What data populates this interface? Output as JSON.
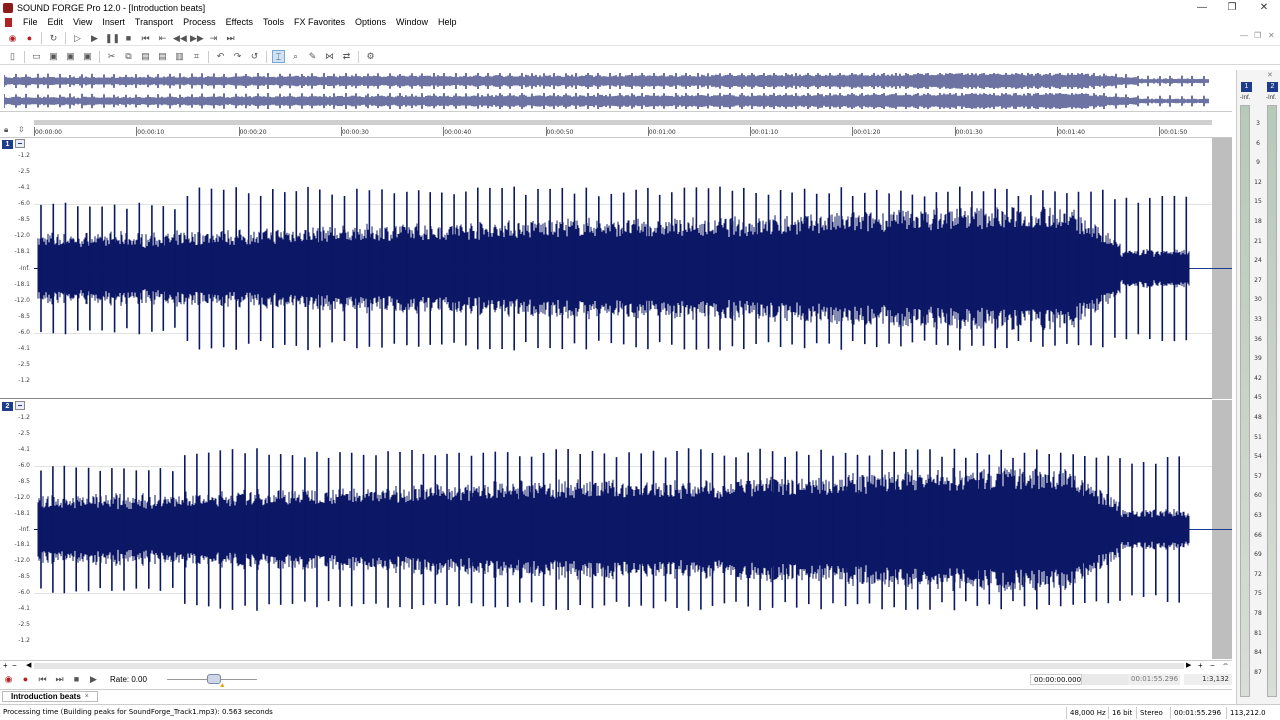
{
  "window": {
    "title": "SOUND FORGE Pro 12.0 - [Introduction beats]",
    "min_glyph": "—",
    "max_glyph": "❐",
    "close_glyph": "✕"
  },
  "menu": [
    "File",
    "Edit",
    "View",
    "Insert",
    "Transport",
    "Process",
    "Effects",
    "Tools",
    "FX Favorites",
    "Options",
    "Window",
    "Help"
  ],
  "transport_icons": [
    "record-arm-icon",
    "record-icon",
    "loop-icon",
    "play-all-icon",
    "play-icon",
    "pause-icon",
    "stop-icon",
    "go-to-start-icon",
    "previous-icon",
    "rewind-icon",
    "forward-icon",
    "next-icon",
    "go-to-end-icon"
  ],
  "standard_icons": [
    "new-icon",
    "open-icon",
    "save-icon",
    "save-as-icon",
    "save-all-icon",
    "cut-icon",
    "copy-icon",
    "paste-icon",
    "mix-icon",
    "crop-icon",
    "trim-icon",
    "undo-icon",
    "redo-icon",
    "repeat-icon",
    "edit-tool-icon",
    "magnify-tool-icon",
    "pencil-tool-icon",
    "envelope-tool-icon",
    "event-tool-icon",
    "plugin-chainer-icon"
  ],
  "ruler": {
    "labels": [
      "00:00:00",
      "00:00:10",
      "00:00:20",
      "00:00:30",
      "00:00:40",
      "00:00:50",
      "00:01:00",
      "00:01:10",
      "00:01:20",
      "00:01:30",
      "00:01:40",
      "00:01:50"
    ]
  },
  "channels": [
    {
      "id": "1",
      "db_labels": [
        "-1.2",
        "-2.5",
        "-4.1",
        "-6.0",
        "-8.5",
        "-12.0",
        "-18.1",
        "-Inf.",
        "-18.1",
        "-12.0",
        "-8.5",
        "-6.0",
        "-4.1",
        "-2.5",
        "-1.2"
      ]
    },
    {
      "id": "2",
      "db_labels": [
        "-1.2",
        "-2.5",
        "-4.1",
        "-6.0",
        "-8.5",
        "-12.0",
        "-18.1",
        "-Inf.",
        "-18.1",
        "-12.0",
        "-8.5",
        "-6.0",
        "-4.1",
        "-2.5",
        "-1.2"
      ]
    }
  ],
  "bottom_transport": {
    "rate_label": "Rate: 0.00",
    "selection_start": "00:00:00.000",
    "selection_end": "00:01:55.296",
    "zoom": "1:3,132"
  },
  "doc_tab": {
    "label": "Introduction beats",
    "close": "×"
  },
  "status": {
    "message": "Processing time (Building peaks for SoundForge_Track1.mp3): 0.563 seconds",
    "sample_rate": "48,000 Hz",
    "bit_depth": "16 bit",
    "channels": "Stereo",
    "length": "00:01:55.296",
    "free_space": "113,212.0 MB"
  },
  "meters": {
    "channel_labels": [
      "1",
      "2"
    ],
    "top_labels": [
      "-Inf.",
      "-Inf."
    ],
    "scale": [
      "3",
      "6",
      "9",
      "12",
      "15",
      "18",
      "21",
      "24",
      "27",
      "30",
      "33",
      "36",
      "39",
      "42",
      "45",
      "48",
      "51",
      "54",
      "57",
      "60",
      "63",
      "66",
      "69",
      "72",
      "75",
      "78",
      "81",
      "84",
      "87"
    ]
  },
  "colors": {
    "waveform": "#0c1766",
    "accent": "#1e3c8c"
  }
}
